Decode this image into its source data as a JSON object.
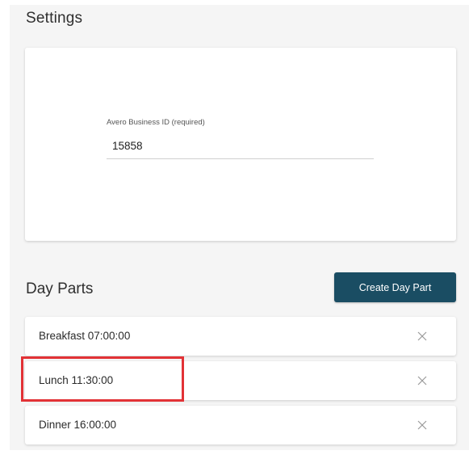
{
  "settings": {
    "title": "Settings",
    "business_id_label": "Avero Business ID (required)",
    "business_id_value": "15858"
  },
  "day_parts": {
    "title": "Day Parts",
    "create_button_label": "Create Day Part",
    "items": [
      {
        "label": "Breakfast 07:00:00",
        "icon": "close-icon"
      },
      {
        "label": "Lunch 11:30:00",
        "icon": "close-icon"
      },
      {
        "label": "Dinner 16:00:00",
        "icon": "close-icon"
      }
    ],
    "highlighted_item": "Lunch 11:30:00"
  },
  "colors": {
    "button_background": "#1a4d63",
    "highlight_border": "#e23236",
    "panel_background": "#f5f5f5"
  }
}
